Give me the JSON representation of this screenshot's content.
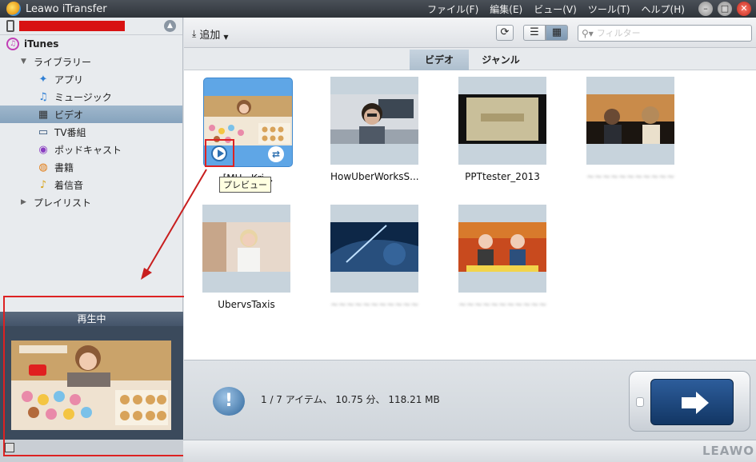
{
  "window": {
    "title": "Leawo iTransfer"
  },
  "menu": [
    "ファイル(F)",
    "編集(E)",
    "ビュー(V)",
    "ツール(T)",
    "ヘルプ(H)"
  ],
  "sidebar": {
    "itunes_label": "iTunes",
    "library_label": "ライブラリー",
    "items": [
      {
        "label": "アプリ",
        "icon": "app-store-icon"
      },
      {
        "label": "ミュージック",
        "icon": "music-note-icon"
      },
      {
        "label": "ビデオ",
        "icon": "video-icon",
        "selected": true
      },
      {
        "label": "TV番組",
        "icon": "tv-icon"
      },
      {
        "label": "ポッドキャスト",
        "icon": "podcast-icon"
      },
      {
        "label": "書籍",
        "icon": "book-icon"
      },
      {
        "label": "着信音",
        "icon": "bell-icon"
      }
    ],
    "playlist_label": "プレイリスト"
  },
  "now_playing": {
    "title": "再生中"
  },
  "toolbar": {
    "add_label": "追加",
    "search_placeholder": "フィルター"
  },
  "tabs": [
    "ビデオ",
    "ジャンル"
  ],
  "videos": [
    {
      "title": "[MU...Kri...",
      "selected": true
    },
    {
      "title": "HowUberWorksS..."
    },
    {
      "title": "PPTtester_2013"
    },
    {
      "title": "~~~~~~~~~~~~",
      "blurred": true
    },
    {
      "title": "UbervsTaxis"
    },
    {
      "title": "~~~~~~~~~~~~",
      "blurred": true
    },
    {
      "title": "~~~~~~~~~~~~",
      "blurred": true
    }
  ],
  "tooltip": "プレビュー",
  "status": {
    "text": "1 / 7 アイテム、 10.75 分、 118.21 MB"
  },
  "brand": "LEAWO"
}
